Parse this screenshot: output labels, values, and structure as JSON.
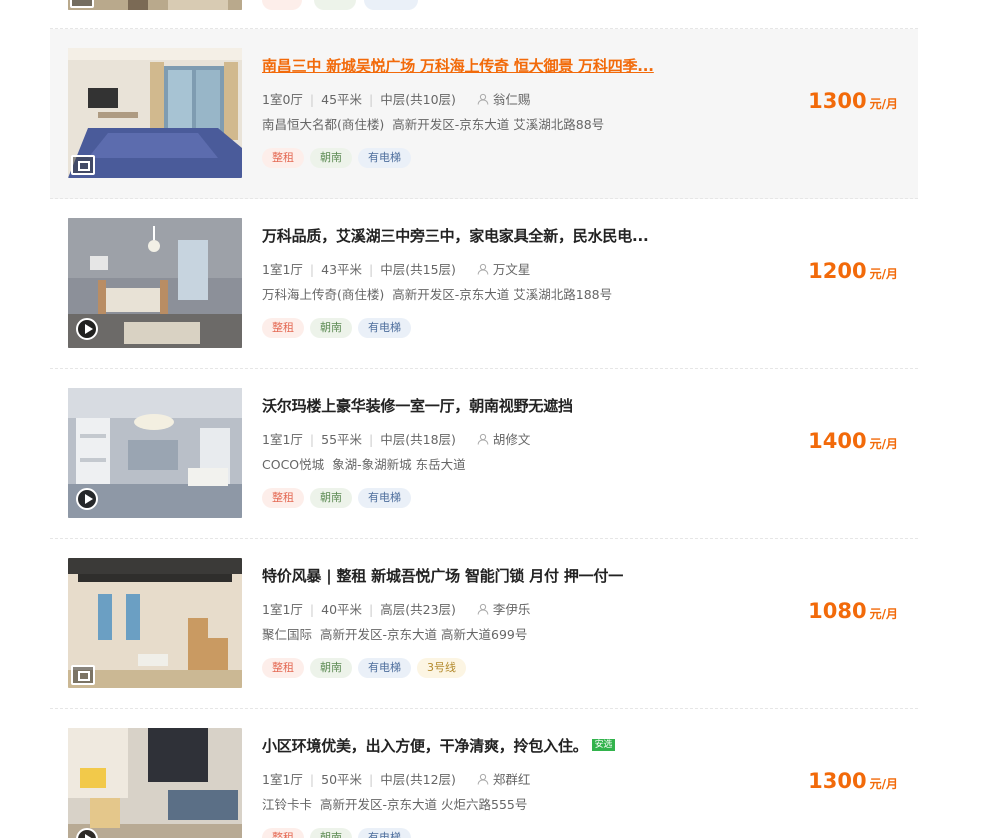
{
  "colors": {
    "accent": "#f26a0a",
    "tag_red": "#e46a54",
    "tag_green": "#5e8c55",
    "tag_blue": "#4f6f9d",
    "tag_yellow": "#b38a2c",
    "anxuan_green": "#32b34c"
  },
  "listings": [
    {
      "title": "南昌三中 新城吴悦广场 万科海上传奇 恒大御景 万科四季...",
      "layout": "1室0厅",
      "area": "45平米",
      "floor": "中层(共10层)",
      "agent": "翁仁赐",
      "community": "南昌恒大名都(商住楼)",
      "location": "高新开发区-京东大道 艾溪湖北路88号",
      "tags": [
        "整租",
        "朝南",
        "有电梯"
      ],
      "price": "1300",
      "price_unit": "元/月",
      "media_icon": "gallery-icon"
    },
    {
      "title": "万科品质，艾溪湖三中旁三中，家电家具全新，民水民电...",
      "layout": "1室1厅",
      "area": "43平米",
      "floor": "中层(共15层)",
      "agent": "万文星",
      "community": "万科海上传奇(商住楼)",
      "location": "高新开发区-京东大道 艾溪湖北路188号",
      "tags": [
        "整租",
        "朝南",
        "有电梯"
      ],
      "price": "1200",
      "price_unit": "元/月",
      "media_icon": "video-play-icon"
    },
    {
      "title": "沃尔玛楼上豪华装修一室一厅，朝南视野无遮挡",
      "layout": "1室1厅",
      "area": "55平米",
      "floor": "中层(共18层)",
      "agent": "胡修文",
      "community": "COCO悦城",
      "location": "象湖-象湖新城 东岳大道",
      "tags": [
        "整租",
        "朝南",
        "有电梯"
      ],
      "price": "1400",
      "price_unit": "元/月",
      "media_icon": "video-play-icon"
    },
    {
      "title": "特价风暴 | 整租 新城吾悦广场 智能门锁 月付 押一付一",
      "layout": "1室1厅",
      "area": "40平米",
      "floor": "高层(共23层)",
      "agent": "李伊乐",
      "community": "聚仁国际",
      "location": "高新开发区-京东大道 高新大道699号",
      "tags": [
        "整租",
        "朝南",
        "有电梯",
        "3号线"
      ],
      "price": "1080",
      "price_unit": "元/月",
      "media_icon": "gallery-icon"
    },
    {
      "title": "小区环境优美，出入方便，干净清爽，拎包入住。",
      "badge": "安选",
      "layout": "1室1厅",
      "area": "50平米",
      "floor": "中层(共12层)",
      "agent": "郑群红",
      "community": "江铃卡卡",
      "location": "高新开发区-京东大道 火炬六路555号",
      "tags": [
        "整租",
        "朝南",
        "有电梯"
      ],
      "price": "1300",
      "price_unit": "元/月",
      "media_icon": "video-play-icon"
    }
  ]
}
